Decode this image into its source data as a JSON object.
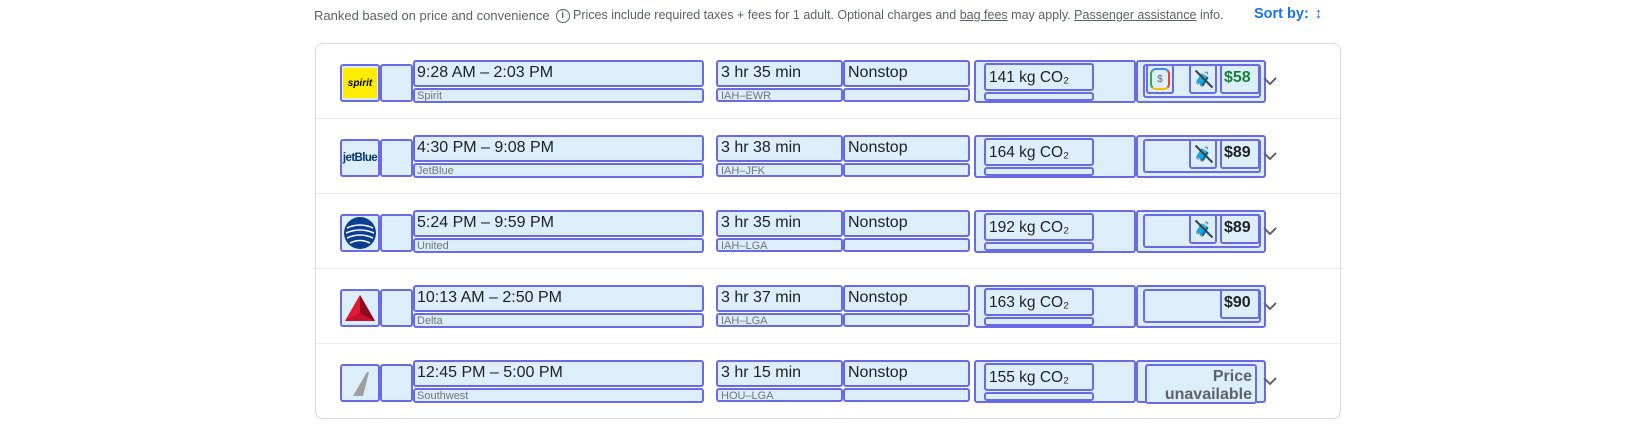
{
  "header": {
    "ranked_text": "Ranked based on price and convenience",
    "note_prefix": "Prices include required taxes + fees for 1 adult. Optional charges and",
    "bag_fees_link": "bag fees",
    "note_middle": "may apply.",
    "passenger_link": "Passenger assistance",
    "note_suffix": "info.",
    "sort_label": "Sort by:",
    "sort_icon": "↕"
  },
  "colors": {
    "accent": "#1a73e8",
    "annotation_fill": "#dceef9",
    "annotation_border": "#6a6ae6",
    "green_price": "#188038"
  },
  "flights": [
    {
      "logo": "spirit",
      "logo_text": "spirit",
      "times": "9:28 AM – 2:03 PM",
      "airline": "Spirit",
      "duration": "3 hr 35 min",
      "route": "IAH–EWR",
      "stops": "Nonstop",
      "co2": "141 kg CO₂",
      "price": "$58",
      "price_green": true,
      "has_shield": true,
      "has_bag_icon": true
    },
    {
      "logo": "jetblue",
      "logo_text": "jetBlue",
      "times": "4:30 PM – 9:08 PM",
      "airline": "JetBlue",
      "duration": "3 hr 38 min",
      "route": "IAH–JFK",
      "stops": "Nonstop",
      "co2": "164 kg CO₂",
      "price": "$89",
      "price_green": false,
      "has_shield": false,
      "has_bag_icon": true
    },
    {
      "logo": "united",
      "logo_text": "",
      "times": "5:24 PM – 9:59 PM",
      "airline": "United",
      "duration": "3 hr 35 min",
      "route": "IAH–LGA",
      "stops": "Nonstop",
      "co2": "192 kg CO₂",
      "price": "$89",
      "price_green": false,
      "has_shield": false,
      "has_bag_icon": true
    },
    {
      "logo": "delta",
      "logo_text": "",
      "times": "10:13 AM – 2:50 PM",
      "airline": "Delta",
      "duration": "3 hr 37 min",
      "route": "IAH–LGA",
      "stops": "Nonstop",
      "co2": "163 kg CO₂",
      "price": "$90",
      "price_green": false,
      "has_shield": false,
      "has_bag_icon": false
    },
    {
      "logo": "southwest",
      "logo_text": "",
      "times": "12:45 PM – 5:00 PM",
      "airline": "Southwest",
      "duration": "3 hr 15 min",
      "route": "HOU–LGA",
      "stops": "Nonstop",
      "co2": "155 kg CO₂",
      "price": "Price unavailable",
      "price_green": false,
      "has_shield": false,
      "has_bag_icon": false
    }
  ]
}
